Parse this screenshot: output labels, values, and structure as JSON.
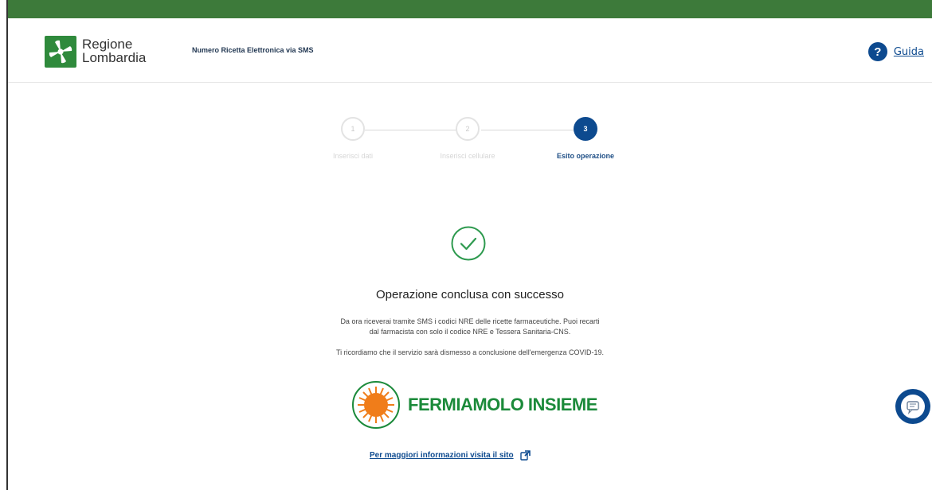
{
  "header": {
    "logo_line1": "Regione",
    "logo_line2": "Lombardia",
    "app_title": "Numero Ricetta Elettronica via SMS",
    "help_label": "Guida"
  },
  "stepper": {
    "steps": [
      {
        "number": "1",
        "label": "Inserisci dati",
        "state": "inactive"
      },
      {
        "number": "2",
        "label": "Inserisci cellulare",
        "state": "inactive"
      },
      {
        "number": "3",
        "label": "Esito operazione",
        "state": "active"
      }
    ]
  },
  "result": {
    "title": "Operazione conclusa con successo",
    "description_line1": "Da ora riceverai tramite SMS i codici NRE delle ricette farmaceutiche. Puoi recarti",
    "description_line2": "dal farmacista con solo il codice NRE e Tessera Sanitaria-CNS.",
    "note": "Ti ricordiamo che il servizio sarà dismesso a conclusione dell'emergenza COVID-19."
  },
  "campaign": {
    "banner_text": "FERMIAMOLO INSIEME"
  },
  "more_info": {
    "link_text": "Per maggiori informazioni visita il sito"
  },
  "colors": {
    "top_bar": "#3d7a3a",
    "primary_blue": "#0d4a8f",
    "success_green": "#2e9a4f",
    "campaign_green": "#1b8a3a",
    "virus_orange": "#f07d1a"
  },
  "icons": {
    "logo": "regione-lombardia-logo",
    "help": "question-icon",
    "success": "check-circle-icon",
    "campaign": "virus-icon",
    "external": "external-link-icon",
    "chat": "chat-icon"
  }
}
